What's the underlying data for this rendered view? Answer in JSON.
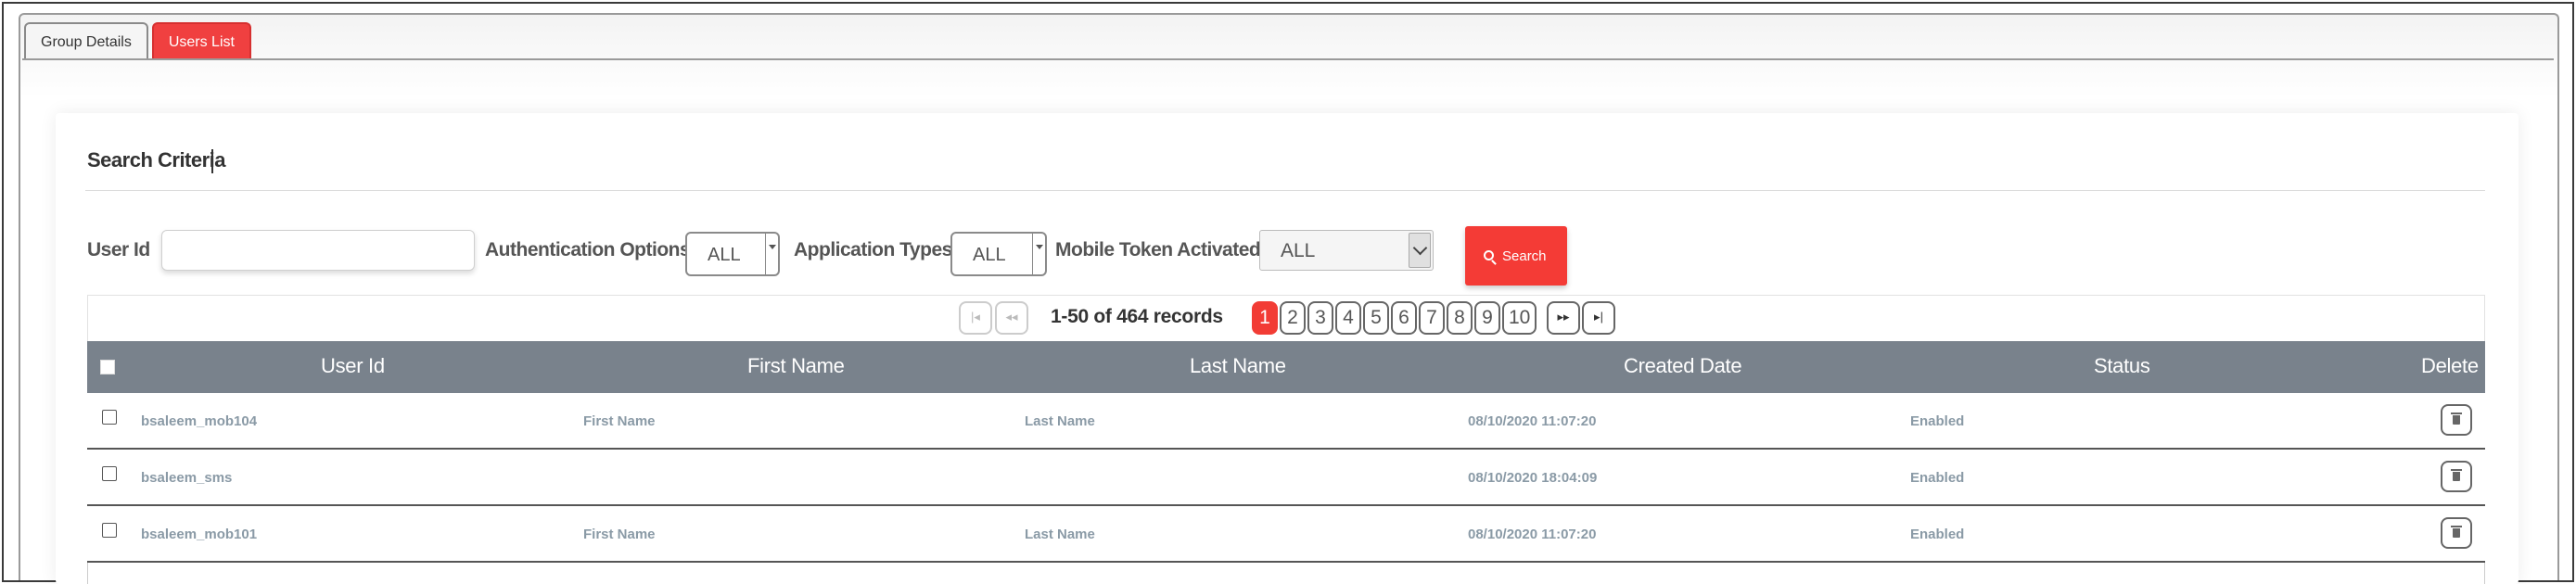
{
  "tabs": [
    {
      "label": "Group Details",
      "active": false
    },
    {
      "label": "Users List",
      "active": true
    }
  ],
  "search": {
    "title": "Search Criteria",
    "user_id_label": "User Id",
    "user_id_value": "",
    "auth_label": "Authentication Options",
    "auth_value": "ALL",
    "app_label": "Application Types",
    "app_value": "ALL",
    "mobile_label": "Mobile Token Activated",
    "mobile_value": "ALL",
    "button_label": "Search"
  },
  "pagination": {
    "first_icon": "first-page-icon",
    "prev_icon": "prev-page-icon",
    "records_text": "1-50 of 464 records",
    "pages": [
      "1",
      "2",
      "3",
      "4",
      "5",
      "6",
      "7",
      "8",
      "9",
      "10"
    ],
    "current_page": "1",
    "next_icon": "next-page-icon",
    "last_icon": "last-page-icon"
  },
  "table": {
    "columns": [
      "User Id",
      "First Name",
      "Last Name",
      "Created Date",
      "Status",
      "Delete"
    ],
    "rows": [
      {
        "user_id": "bsaleem_mob104",
        "first_name": "First Name",
        "last_name": "Last Name",
        "created": "08/10/2020 11:07:20",
        "status": "Enabled"
      },
      {
        "user_id": "bsaleem_sms",
        "first_name": "",
        "last_name": "",
        "created": "08/10/2020 18:04:09",
        "status": "Enabled"
      },
      {
        "user_id": "bsaleem_mob101",
        "first_name": "First Name",
        "last_name": "Last Name",
        "created": "08/10/2020 11:07:20",
        "status": "Enabled"
      }
    ]
  },
  "colors": {
    "accent": "#f23c35",
    "header_bg": "#79828c",
    "cell_text": "#8a9aa6"
  }
}
